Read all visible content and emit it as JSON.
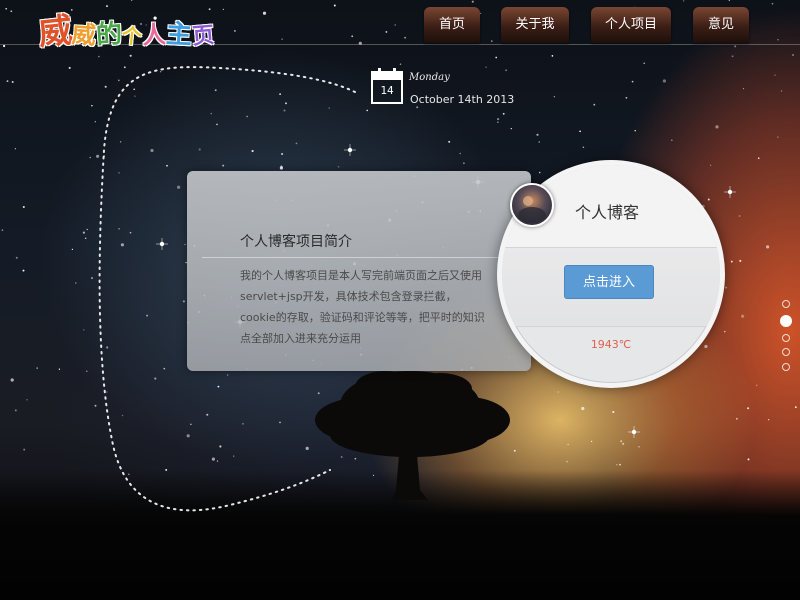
{
  "header": {
    "logo_chars": [
      "威",
      "威",
      "的",
      "个",
      "人",
      "主",
      "页"
    ],
    "nav": [
      {
        "label": "首页"
      },
      {
        "label": "关于我"
      },
      {
        "label": "个人项目"
      },
      {
        "label": "意见"
      }
    ]
  },
  "date_widget": {
    "day_number": "14",
    "weekday": "Monday",
    "full_date": "October 14th 2013"
  },
  "intro": {
    "title": "个人博客项目简介",
    "text": "我的个人博客项目是本人写完前端页面之后又使用servlet+jsp开发，具体技术包含登录拦截，cookie的存取，验证码和评论等等，把平时的知识点全部加入进来充分运用"
  },
  "circle_card": {
    "title": "个人博客",
    "button_label": "点击进入",
    "stat": "1943℃"
  },
  "pager": {
    "count": 5,
    "active_index": 1
  },
  "colors": {
    "nav_bg": "#3a1e15",
    "button_blue": "#5b9bd5",
    "stat_red": "#e0614d"
  }
}
